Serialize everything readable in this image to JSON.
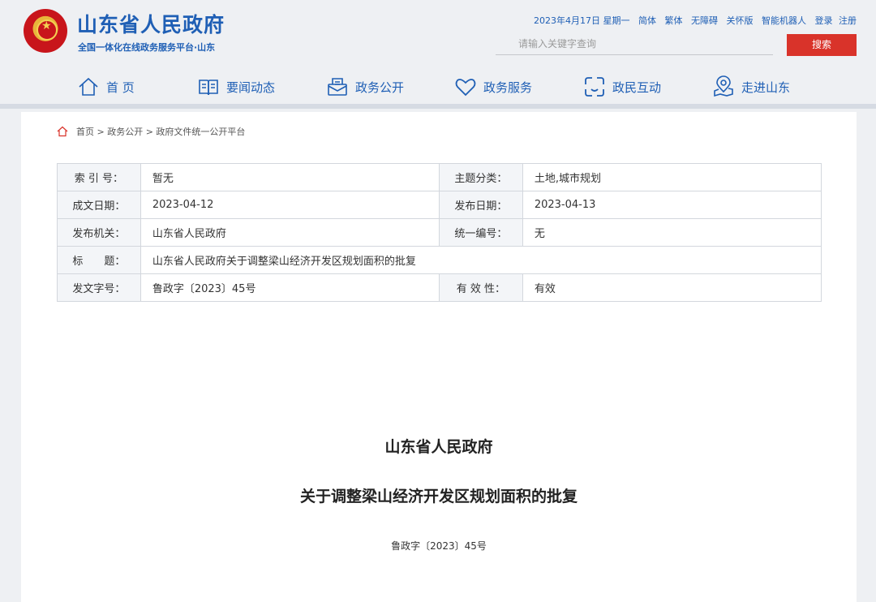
{
  "header": {
    "site_title": "山东省人民政府",
    "site_subtitle": "全国一体化在线政务服务平台·山东",
    "date": "2023年4月17日 星期一",
    "links": [
      "简体",
      "繁体",
      "无障碍",
      "关怀版",
      "智能机器人",
      "登录",
      "注册"
    ],
    "search_placeholder": "请输入关键字查询",
    "search_button": "搜索"
  },
  "nav": {
    "items": [
      {
        "label": "首 页",
        "icon": "home-icon"
      },
      {
        "label": "要闻动态",
        "icon": "news-icon"
      },
      {
        "label": "政务公开",
        "icon": "inbox-icon"
      },
      {
        "label": "政务服务",
        "icon": "heart-icon"
      },
      {
        "label": "政民互动",
        "icon": "interact-icon"
      },
      {
        "label": "走进山东",
        "icon": "location-icon"
      }
    ]
  },
  "breadcrumb": {
    "text": "首页 > 政务公开 > 政府文件统一公开平台"
  },
  "meta": {
    "index_label": "索 引 号：",
    "index_value": "暂无",
    "topic_label": "主题分类：",
    "topic_value": "土地,城市规划",
    "created_label": "成文日期：",
    "created_value": "2023-04-12",
    "published_label": "发布日期：",
    "published_value": "2023-04-13",
    "issuer_label": "发布机关：",
    "issuer_value": "山东省人民政府",
    "serial_label": "统一编号：",
    "serial_value": "无",
    "title_label": "标　　题：",
    "title_value": "山东省人民政府关于调整梁山经济开发区规划面积的批复",
    "docno_label": "发文字号：",
    "docno_value": "鲁政字〔2023〕45号",
    "validity_label": "有 效 性：",
    "validity_value": "有效"
  },
  "document": {
    "issuer": "山东省人民政府",
    "title": "关于调整梁山经济开发区规划面积的批复",
    "number": "鲁政字〔2023〕45号"
  },
  "colors": {
    "brand": "#1f5fb5",
    "accent_red": "#d9332a",
    "page_bg": "#eef0f3"
  }
}
